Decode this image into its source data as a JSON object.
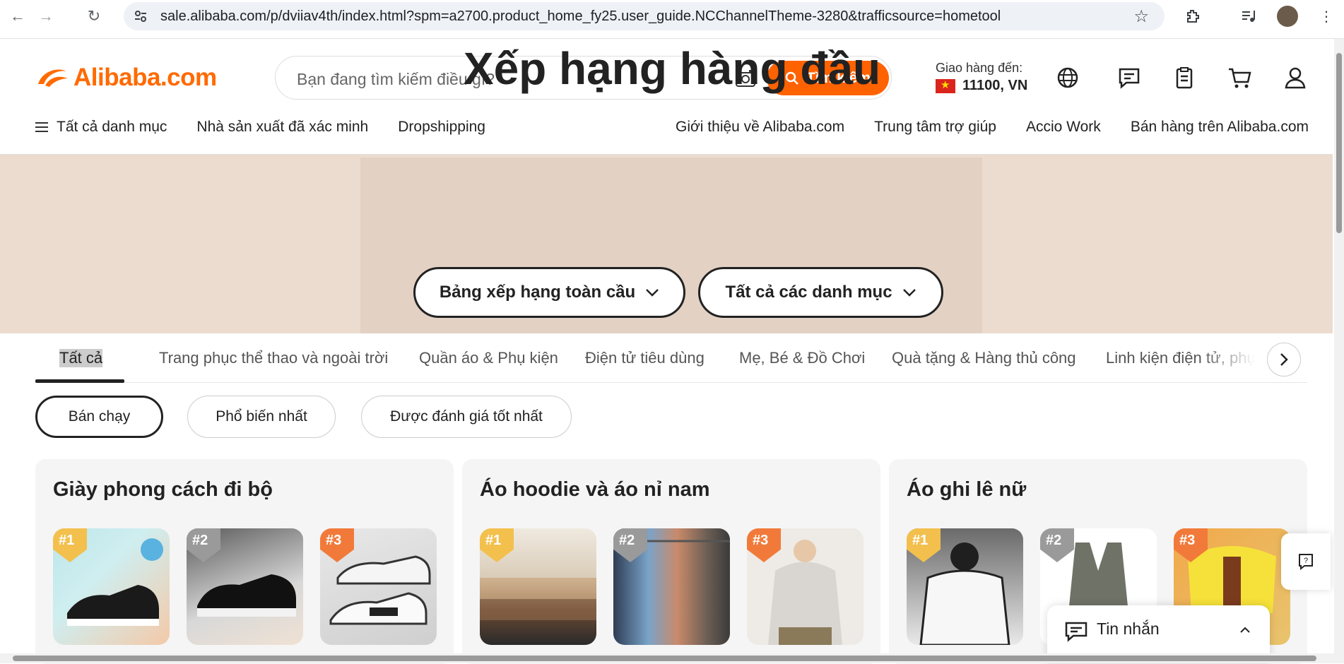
{
  "browser": {
    "url": "sale.alibaba.com/p/dviiav4th/index.html?spm=a2700.product_home_fy25.user_guide.NCChannelTheme-3280&trafficsource=hometool"
  },
  "header": {
    "logo_text": "Alibaba.com",
    "search_placeholder": "Bạn đang tìm kiếm điều gì?",
    "search_button": "Tìm kiếm",
    "deliver_label": "Giao hàng đến:",
    "deliver_location": "11100, VN"
  },
  "subnav": {
    "left": [
      "Tất cả danh mục",
      "Nhà sản xuất đã xác minh",
      "Dropshipping"
    ],
    "right": [
      "Giới thiệu về Alibaba.com",
      "Trung tâm trợ giúp",
      "Accio Work",
      "Bán hàng trên Alibaba.com"
    ]
  },
  "hero": {
    "title": "Xếp hạng hàng đầu",
    "dropdown_1": "Bảng xếp hạng toàn cầu",
    "dropdown_2": "Tất cả các danh mục"
  },
  "category_tabs": [
    "Tất cả",
    "Trang phục thể thao và ngoài trời",
    "Quần áo & Phụ kiện",
    "Điện tử tiêu dùng",
    "Mẹ, Bé & Đồ Chơi",
    "Quà tặng & Hàng thủ công",
    "Linh kiện điện tử, phụ"
  ],
  "filters": [
    "Bán chạy",
    "Phổ biến nhất",
    "Được đánh giá tốt nhất"
  ],
  "cards": [
    {
      "title": "Giày phong cách đi bộ",
      "ranks": [
        "#1",
        "#2",
        "#3"
      ]
    },
    {
      "title": "Áo hoodie và áo nỉ nam",
      "ranks": [
        "#1",
        "#2",
        "#3"
      ]
    },
    {
      "title": "Áo ghi lê nữ",
      "ranks": [
        "#1",
        "#2",
        "#3"
      ]
    }
  ],
  "messages": {
    "label": "Tin nhắn"
  },
  "colors": {
    "brand": "#ff6a00",
    "search_button": "#ff6200",
    "hero_bg": "#ecdcd0"
  }
}
